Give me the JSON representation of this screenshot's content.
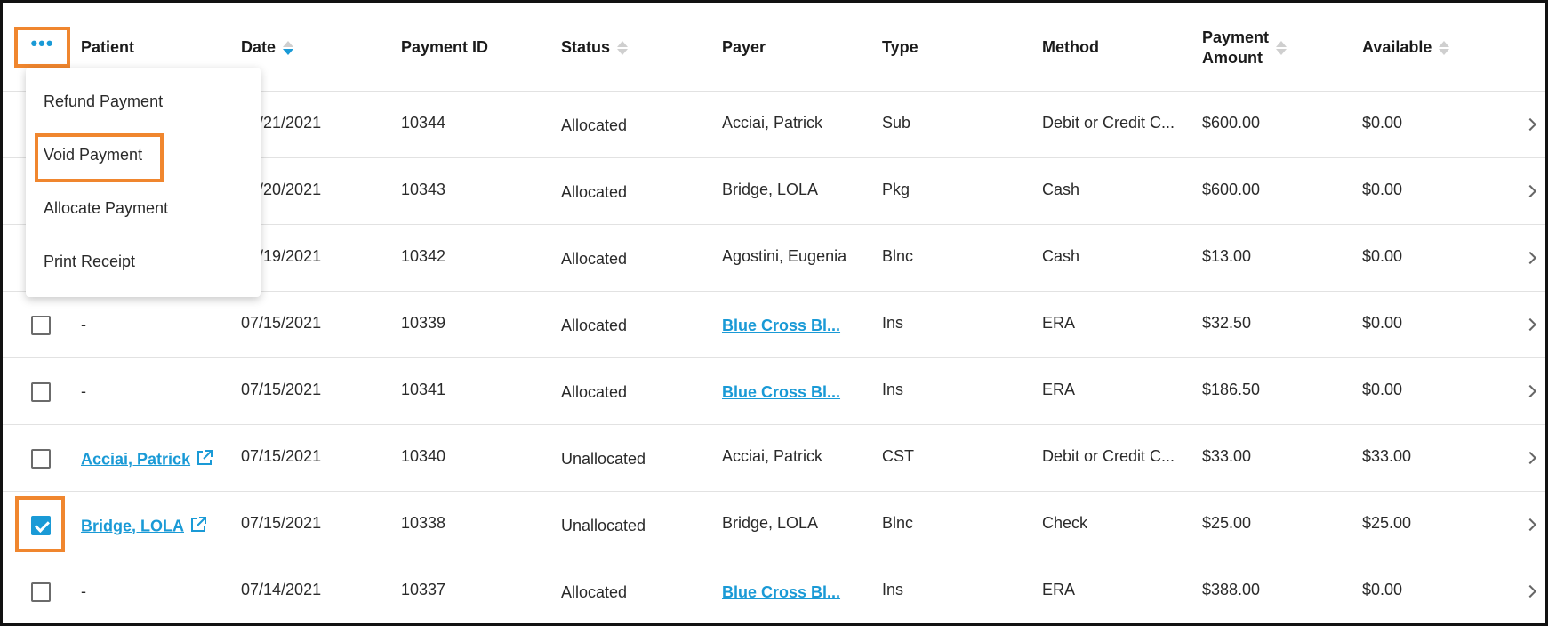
{
  "header": {
    "more_label": "•••",
    "columns": {
      "patient": "Patient",
      "date": "Date",
      "payment_id": "Payment ID",
      "status": "Status",
      "payer": "Payer",
      "type": "Type",
      "method": "Method",
      "amount_line1": "Payment",
      "amount_line2": "Amount",
      "available": "Available"
    }
  },
  "menu": {
    "refund": "Refund Payment",
    "void": "Void Payment",
    "allocate": "Allocate Payment",
    "print": "Print Receipt"
  },
  "rows": [
    {
      "patient": "",
      "date": "07/21/2021",
      "date_visible": "/21/2021",
      "id": "10344",
      "status": "Allocated",
      "payer": "Acciai, Patrick",
      "type": "Sub",
      "method": "Debit or Credit C...",
      "amount": "$600.00",
      "available": "$0.00"
    },
    {
      "patient": "",
      "date": "07/20/2021",
      "date_visible": "/20/2021",
      "id": "10343",
      "status": "Allocated",
      "payer": "Bridge, LOLA",
      "type": "Pkg",
      "method": "Cash",
      "amount": "$600.00",
      "available": "$0.00"
    },
    {
      "patient": "",
      "date": "07/19/2021",
      "date_visible": "/19/2021",
      "id": "10342",
      "status": "Allocated",
      "payer": "Agostini, Eugenia",
      "type": "Blnc",
      "method": "Cash",
      "amount": "$13.00",
      "available": "$0.00"
    },
    {
      "patient": "-",
      "date": "07/15/2021",
      "id": "10339",
      "status": "Allocated",
      "payer": "Blue Cross Bl...",
      "type": "Ins",
      "method": "ERA",
      "amount": "$32.50",
      "available": "$0.00"
    },
    {
      "patient": "-",
      "date": "07/15/2021",
      "id": "10341",
      "status": "Allocated",
      "payer": "Blue Cross Bl...",
      "type": "Ins",
      "method": "ERA",
      "amount": "$186.50",
      "available": "$0.00"
    },
    {
      "patient": "Acciai, Patrick",
      "date": "07/15/2021",
      "id": "10340",
      "status": "Unallocated",
      "payer": "Acciai, Patrick",
      "type": "CST",
      "method": "Debit or Credit C...",
      "amount": "$33.00",
      "available": "$33.00"
    },
    {
      "patient": "Bridge, LOLA",
      "date": "07/15/2021",
      "id": "10338",
      "status": "Unallocated",
      "payer": "Bridge, LOLA",
      "type": "Blnc",
      "method": "Check",
      "amount": "$25.00",
      "available": "$25.00"
    },
    {
      "patient": "-",
      "date": "07/14/2021",
      "id": "10337",
      "status": "Allocated",
      "payer": "Blue Cross Bl...",
      "type": "Ins",
      "method": "ERA",
      "amount": "$388.00",
      "available": "$0.00"
    }
  ],
  "colors": {
    "accent": "#1a9ad6",
    "highlight": "#f0862e"
  }
}
